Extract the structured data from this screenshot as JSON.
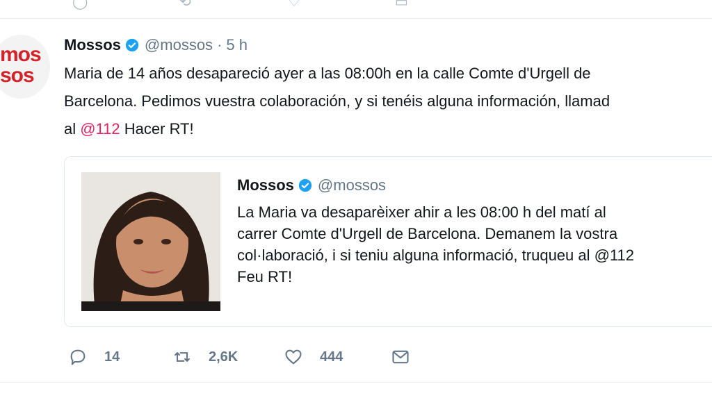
{
  "tweet": {
    "author_name": "Mossos",
    "handle": "@mossos",
    "separator": "·",
    "time": "5 h",
    "avatar_logo": [
      "mos",
      "sos"
    ],
    "text_lines": [
      "Maria de 14 años desapareció ayer a las 08:00h en la calle Comte d'Urgell de",
      "Barcelona. Pedimos vuestra colaboración, y si tenéis alguna información, llamad"
    ],
    "text_line3_prefix": "al ",
    "mention": "@112",
    "text_line3_suffix": " Hacer RT!"
  },
  "quoted": {
    "author_name": "Mossos",
    "handle": "@mossos",
    "text_lines": [
      "La Maria va desaparèixer ahir a les 08:00 h del matí al",
      "carrer Comte d'Urgell de Barcelona. Demanem la vostra",
      "col·laboració, i si teniu alguna informació, truqueu al @112",
      "Feu RT!"
    ]
  },
  "actions": {
    "replies": "14",
    "retweets": "2,6K",
    "likes": "444"
  },
  "colors": {
    "mention": "#e0245e",
    "muted": "#657786",
    "verified": "#1da1f2",
    "logo_red": "#d2232a",
    "divider": "#e6ecf0"
  },
  "icons": [
    "verified-badge-icon",
    "reply-icon",
    "retweet-icon",
    "like-icon",
    "message-icon"
  ]
}
